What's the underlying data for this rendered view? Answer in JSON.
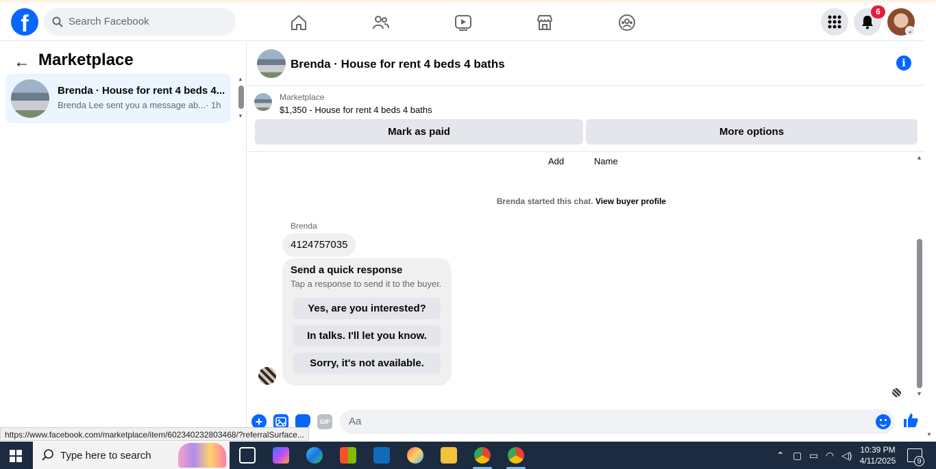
{
  "header": {
    "logo_letter": "f",
    "search_placeholder": "Search Facebook",
    "notification_count": "6"
  },
  "left_panel": {
    "title": "Marketplace",
    "conversation": {
      "title": "Brenda · House for rent 4 beds 4...",
      "preview": "Brenda Lee sent you a message ab...",
      "time": "· 1h"
    }
  },
  "chat": {
    "title": "Brenda · House for rent 4 beds 4 baths",
    "info_symbol": "i",
    "item_label": "Marketplace",
    "item_price_title": "$1,350 - House for rent 4 beds 4 baths",
    "mark_paid_label": "Mark as paid",
    "more_options_label": "More options",
    "add_label": "Add",
    "name_label": "Name",
    "started_text": "Brenda started this chat.",
    "view_buyer_profile": "View buyer profile",
    "sender_name": "Brenda",
    "message_text": "4124757035",
    "quick_response": {
      "title": "Send a quick response",
      "subtitle": "Tap a response to send it to the buyer.",
      "options": [
        "Yes, are you interested?",
        "In talks. I'll let you know.",
        "Sorry, it's not available."
      ]
    },
    "composer_placeholder": "Aa",
    "gif_label": "GIF"
  },
  "status_url": "https://www.facebook.com/marketplace/item/602340232803468/?referralSurface...",
  "taskbar": {
    "search_placeholder": "Type here to search",
    "time": "10:39 PM",
    "date": "4/11/2025",
    "notification_count": "9"
  },
  "colors": {
    "brand_blue": "#0866ff",
    "badge_red": "#e41e3f",
    "taskbar": "#1c2b3f"
  }
}
